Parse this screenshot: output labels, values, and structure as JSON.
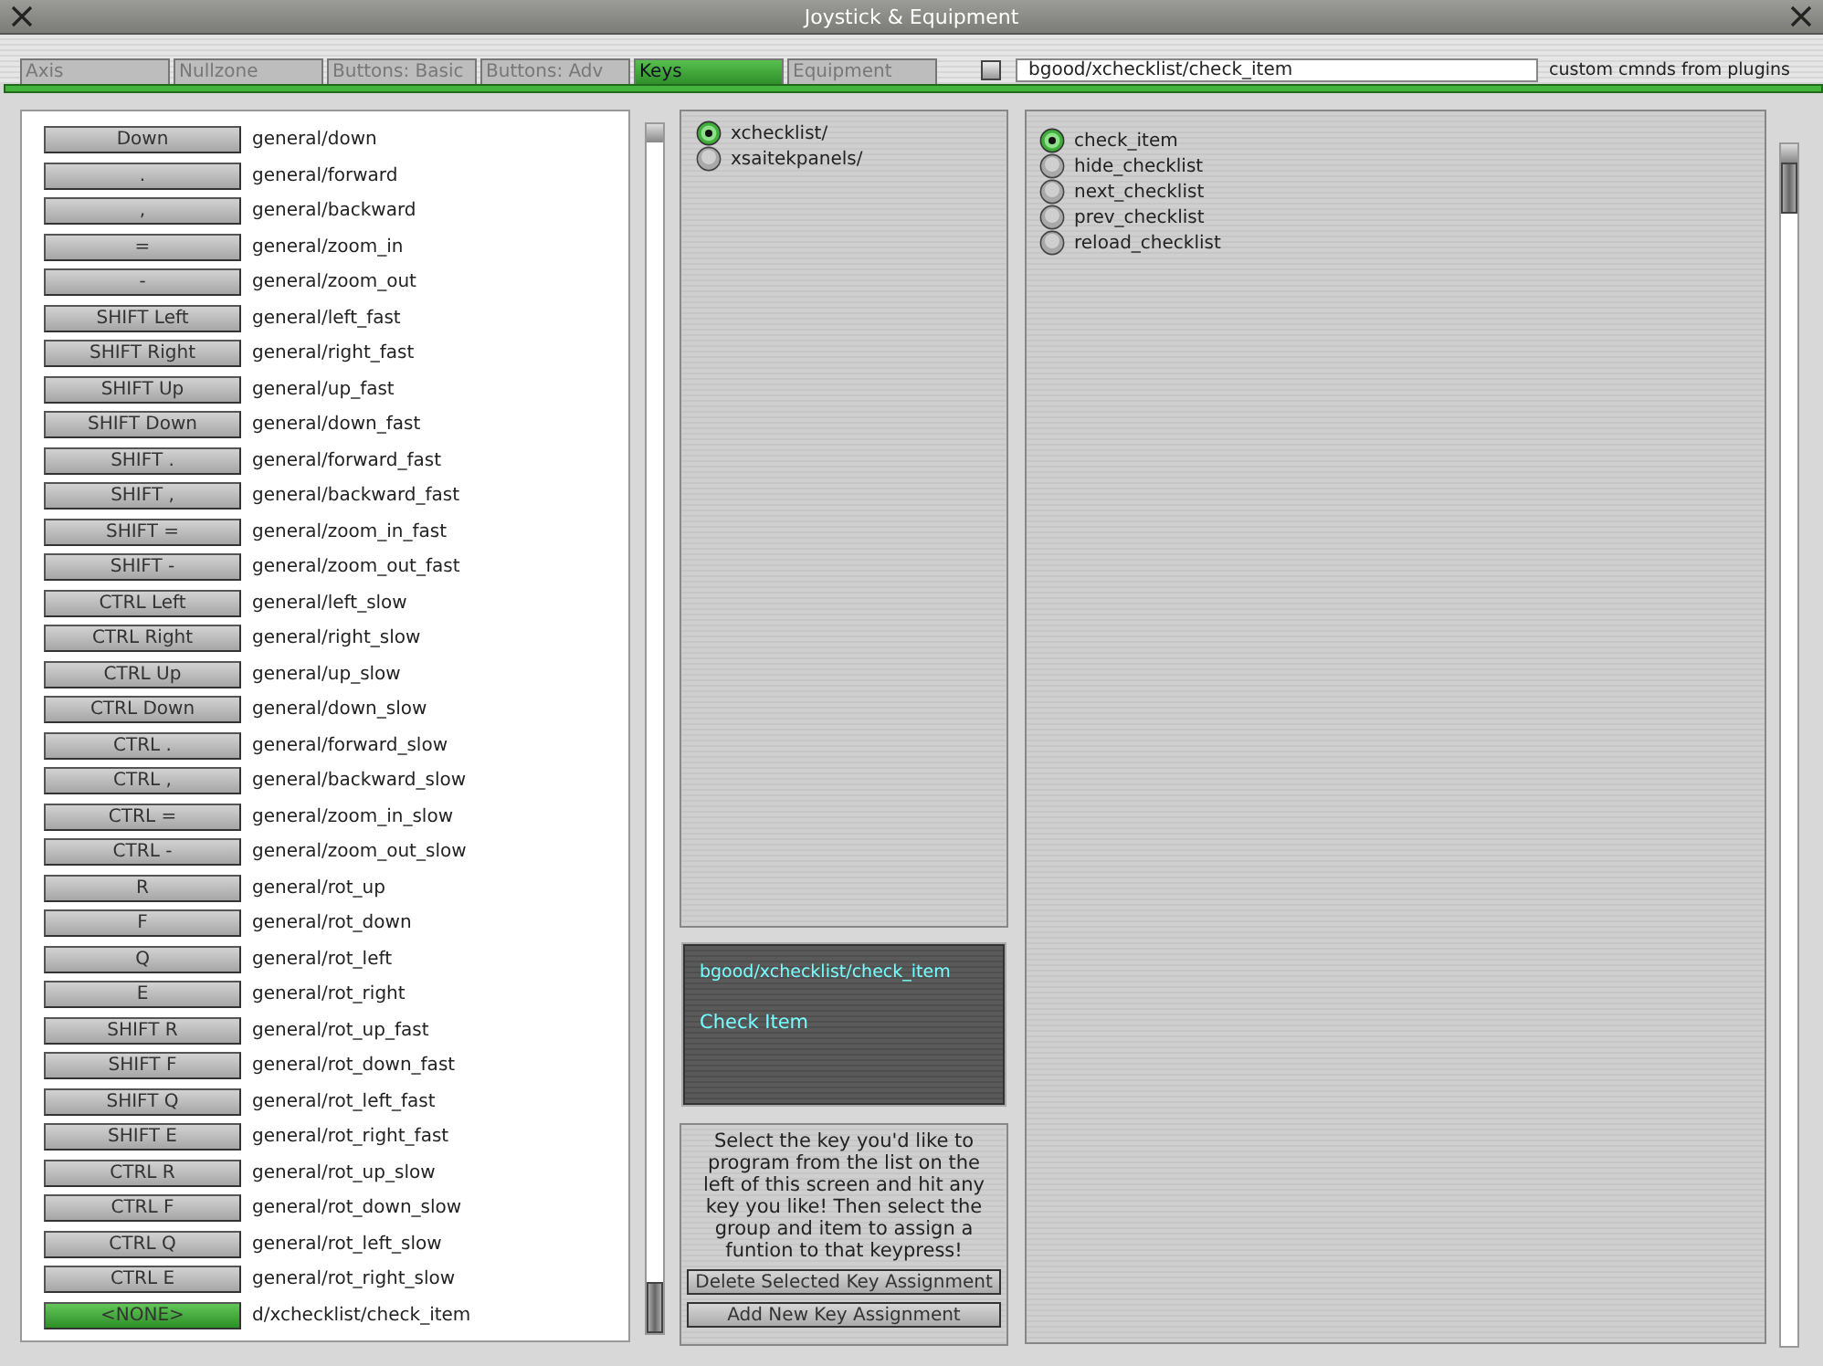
{
  "window": {
    "title": "Joystick & Equipment"
  },
  "tabs": [
    {
      "label": "Axis",
      "selected": false
    },
    {
      "label": "Nullzone",
      "selected": false
    },
    {
      "label": "Buttons: Basic",
      "selected": false
    },
    {
      "label": "Buttons: Adv",
      "selected": false
    },
    {
      "label": "Keys",
      "selected": true
    },
    {
      "label": "Equipment",
      "selected": false
    }
  ],
  "custom_commands": {
    "checked": false,
    "value": "bgood/xchecklist/check_item",
    "label": "custom cmnds from plugins"
  },
  "key_assignments": [
    {
      "key": "Down",
      "command": "general/down",
      "selected": false
    },
    {
      "key": ".",
      "command": "general/forward",
      "selected": false
    },
    {
      "key": ",",
      "command": "general/backward",
      "selected": false
    },
    {
      "key": "=",
      "command": "general/zoom_in",
      "selected": false
    },
    {
      "key": "-",
      "command": "general/zoom_out",
      "selected": false
    },
    {
      "key": "SHIFT Left",
      "command": "general/left_fast",
      "selected": false
    },
    {
      "key": "SHIFT Right",
      "command": "general/right_fast",
      "selected": false
    },
    {
      "key": "SHIFT Up",
      "command": "general/up_fast",
      "selected": false
    },
    {
      "key": "SHIFT Down",
      "command": "general/down_fast",
      "selected": false
    },
    {
      "key": "SHIFT .",
      "command": "general/forward_fast",
      "selected": false
    },
    {
      "key": "SHIFT ,",
      "command": "general/backward_fast",
      "selected": false
    },
    {
      "key": "SHIFT =",
      "command": "general/zoom_in_fast",
      "selected": false
    },
    {
      "key": "SHIFT -",
      "command": "general/zoom_out_fast",
      "selected": false
    },
    {
      "key": "CTRL Left",
      "command": "general/left_slow",
      "selected": false
    },
    {
      "key": "CTRL Right",
      "command": "general/right_slow",
      "selected": false
    },
    {
      "key": "CTRL Up",
      "command": "general/up_slow",
      "selected": false
    },
    {
      "key": "CTRL Down",
      "command": "general/down_slow",
      "selected": false
    },
    {
      "key": "CTRL .",
      "command": "general/forward_slow",
      "selected": false
    },
    {
      "key": "CTRL ,",
      "command": "general/backward_slow",
      "selected": false
    },
    {
      "key": "CTRL =",
      "command": "general/zoom_in_slow",
      "selected": false
    },
    {
      "key": "CTRL -",
      "command": "general/zoom_out_slow",
      "selected": false
    },
    {
      "key": "R",
      "command": "general/rot_up",
      "selected": false
    },
    {
      "key": "F",
      "command": "general/rot_down",
      "selected": false
    },
    {
      "key": "Q",
      "command": "general/rot_left",
      "selected": false
    },
    {
      "key": "E",
      "command": "general/rot_right",
      "selected": false
    },
    {
      "key": "SHIFT R",
      "command": "general/rot_up_fast",
      "selected": false
    },
    {
      "key": "SHIFT F",
      "command": "general/rot_down_fast",
      "selected": false
    },
    {
      "key": "SHIFT Q",
      "command": "general/rot_left_fast",
      "selected": false
    },
    {
      "key": "SHIFT E",
      "command": "general/rot_right_fast",
      "selected": false
    },
    {
      "key": "CTRL R",
      "command": "general/rot_up_slow",
      "selected": false
    },
    {
      "key": "CTRL F",
      "command": "general/rot_down_slow",
      "selected": false
    },
    {
      "key": "CTRL Q",
      "command": "general/rot_left_slow",
      "selected": false
    },
    {
      "key": "CTRL E",
      "command": "general/rot_right_slow",
      "selected": false
    },
    {
      "key": "<NONE>",
      "command": "d/xchecklist/check_item",
      "selected": true
    }
  ],
  "groups": [
    {
      "label": "xchecklist/",
      "selected": true
    },
    {
      "label": "xsaitekpanels/",
      "selected": false
    }
  ],
  "command_info": {
    "path": "bgood/xchecklist/check_item",
    "description": "Check Item"
  },
  "help": {
    "text": "Select the key you'd like to program from the list on the left of this screen and hit any key you like! Then select the group and item to assign a funtion to that keypress!"
  },
  "buttons": [
    "Delete Selected Key Assignment",
    "Add New Key Assignment"
  ],
  "items": [
    {
      "label": "check_item",
      "selected": true
    },
    {
      "label": "hide_checklist",
      "selected": false
    },
    {
      "label": "next_checklist",
      "selected": false
    },
    {
      "label": "prev_checklist",
      "selected": false
    },
    {
      "label": "reload_checklist",
      "selected": false
    }
  ]
}
